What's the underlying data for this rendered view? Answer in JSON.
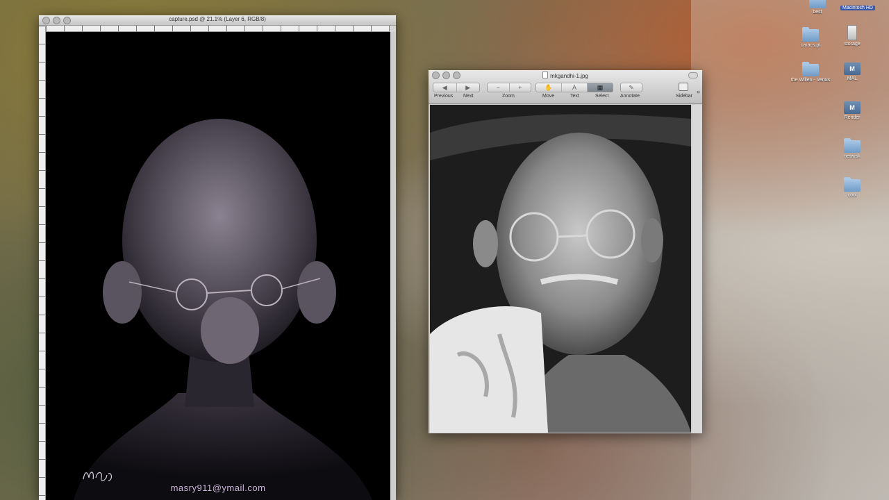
{
  "photoshop": {
    "title": "capture.psd @ 21.1% (Layer 6, RGB/8)",
    "email": "masry911@ymail.com"
  },
  "preview": {
    "title": "mkgandhi-1.jpg",
    "toolbar": {
      "previous": "Previous",
      "next": "Next",
      "zoom": "Zoom",
      "move": "Move",
      "text": "Text",
      "select": "Select",
      "annotate": "Annotate",
      "sidebar": "Sidebar"
    }
  },
  "desktop": {
    "drive_label": "Macintosh HD",
    "icons": [
      {
        "label": "best"
      },
      {
        "label": "caracs.pt"
      },
      {
        "label": "storage"
      },
      {
        "label": "the Willen - Venus"
      },
      {
        "label": "MAL"
      },
      {
        "label": "Render"
      },
      {
        "label": "netwisk"
      },
      {
        "label": "cool"
      }
    ]
  }
}
